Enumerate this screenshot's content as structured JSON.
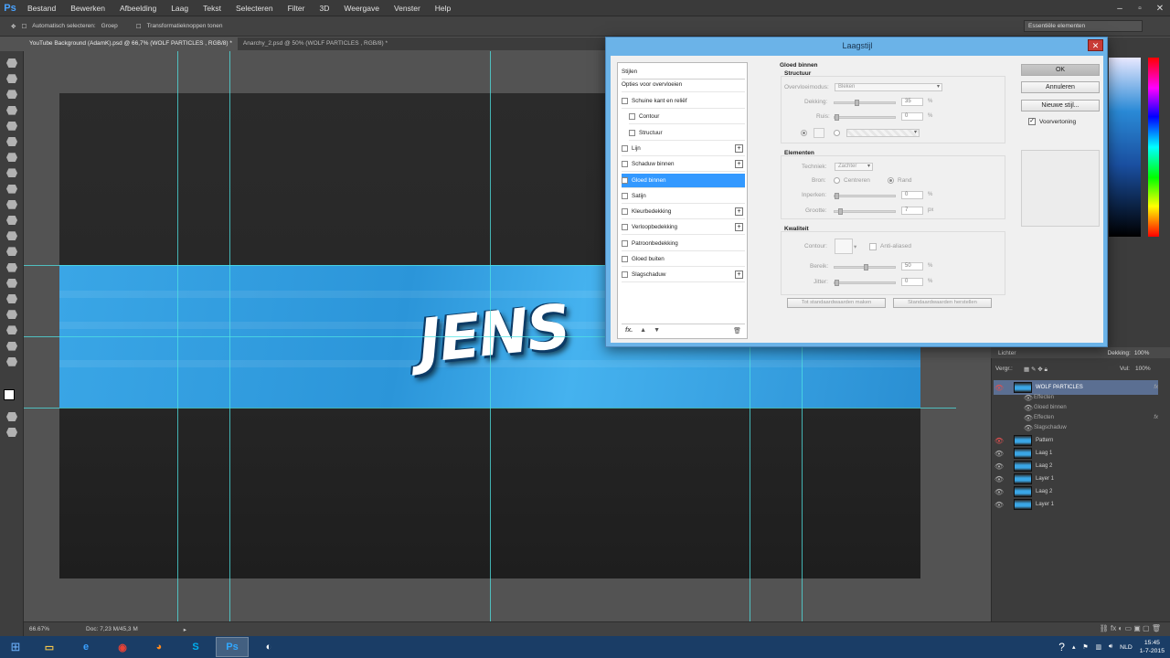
{
  "app": {
    "logo": "Ps",
    "menu": [
      "Bestand",
      "Bewerken",
      "Afbeelding",
      "Laag",
      "Tekst",
      "Selecteren",
      "Filter",
      "3D",
      "Weergave",
      "Venster",
      "Help"
    ],
    "options_bar": {
      "auto_select": "Automatisch selecteren:",
      "auto_select_value": "Groep",
      "transform": "Transformatieknoppen tonen",
      "workspace": "Essentiële elementen"
    },
    "tabs": [
      "YouTube Background (AdamK).psd @ 66,7% (WOLF PARTICLES , RGB/8) *",
      "Anarchy_2.psd @ 50% (WOLF PARTICLES , RGB/8) *"
    ],
    "status": {
      "zoom": "66.67%",
      "doc": "Doc: 7,23 M/45,3 M"
    }
  },
  "artwork": {
    "logo_text": "JENS"
  },
  "dialog": {
    "title": "Laagstijl",
    "styles_list": {
      "header": "Stijlen",
      "blending": "Opties voor overvloeien",
      "items": [
        {
          "label": "Schuine kant en reliëf",
          "plus": false,
          "indent": false,
          "selected": false
        },
        {
          "label": "Contour",
          "plus": false,
          "indent": true,
          "selected": false
        },
        {
          "label": "Structuur",
          "plus": false,
          "indent": true,
          "selected": false
        },
        {
          "label": "Lijn",
          "plus": true,
          "indent": false,
          "selected": false
        },
        {
          "label": "Schaduw binnen",
          "plus": true,
          "indent": false,
          "selected": false
        },
        {
          "label": "Gloed binnen",
          "plus": false,
          "indent": false,
          "selected": true
        },
        {
          "label": "Satijn",
          "plus": false,
          "indent": false,
          "selected": false
        },
        {
          "label": "Kleurbedekking",
          "plus": true,
          "indent": false,
          "selected": false
        },
        {
          "label": "Verloopbedekking",
          "plus": true,
          "indent": false,
          "selected": false
        },
        {
          "label": "Patroonbedekking",
          "plus": false,
          "indent": false,
          "selected": false
        },
        {
          "label": "Gloed buiten",
          "plus": false,
          "indent": false,
          "selected": false
        },
        {
          "label": "Slagschaduw",
          "plus": true,
          "indent": false,
          "selected": false
        }
      ],
      "footer_fx": "fx."
    },
    "settings": {
      "section_title": "Gloed binnen",
      "structure_title": "Structuur",
      "blend_mode_label": "Overvloeimodus:",
      "blend_mode_value": "Bleken",
      "opacity_label": "Dekking:",
      "opacity_value": "35",
      "noise_label": "Ruis:",
      "noise_value": "0",
      "elements_title": "Elementen",
      "technique_label": "Techniek:",
      "technique_value": "Zachter",
      "source_label": "Bron:",
      "source_center": "Centreren",
      "source_edge": "Rand",
      "choke_label": "Inperken:",
      "choke_value": "0",
      "size_label": "Grootte:",
      "size_value": "7",
      "quality_title": "Kwaliteit",
      "contour_label": "Contour:",
      "antialias_label": "Anti-aliased",
      "range_label": "Bereik:",
      "range_value": "50",
      "jitter_label": "Jitter:",
      "jitter_value": "0",
      "percent": "%",
      "px": "px",
      "make_default": "Tot standaardwaarden maken",
      "reset_default": "Standaardwaarden herstellen"
    },
    "buttons": {
      "ok": "OK",
      "cancel": "Annuleren",
      "new_style": "Nieuwe stijl...",
      "preview": "Voorvertoning"
    }
  },
  "layers": {
    "blend_mode": "Lichter",
    "opacity_label": "Dekking:",
    "opacity_value": "100%",
    "fill_label": "Vul:",
    "fill_value": "100%",
    "lock_label": "Vergr.:",
    "rows": [
      {
        "label": "WOLF PARTICLES",
        "kind": "layer",
        "fx": true,
        "selected": true
      },
      {
        "label": "Effecten",
        "kind": "sub",
        "fx": false,
        "selected": false
      },
      {
        "label": "Gloed binnen",
        "kind": "sub",
        "fx": false,
        "selected": false
      },
      {
        "label": "Effecten",
        "kind": "sub",
        "fx": true,
        "selected": false
      },
      {
        "label": "Slagschaduw",
        "kind": "sub",
        "fx": false,
        "selected": false
      },
      {
        "label": "Pattern",
        "kind": "layer",
        "fx": false,
        "selected": false
      },
      {
        "label": "Laag 1",
        "kind": "layer",
        "fx": false,
        "selected": false
      },
      {
        "label": "Laag 2",
        "kind": "layer",
        "fx": false,
        "selected": false
      },
      {
        "label": "Layer 1",
        "kind": "layer",
        "fx": false,
        "selected": false
      },
      {
        "label": "Laag 2",
        "kind": "layer",
        "fx": false,
        "selected": false
      },
      {
        "label": "Layer 1",
        "kind": "layer",
        "fx": false,
        "selected": false
      }
    ]
  },
  "taskbar": {
    "language": "NLD",
    "time": "15:45",
    "date": "1-7-2015",
    "apps": [
      {
        "name": "file-explorer-icon",
        "glyph": "▭",
        "color": "#f3c44b",
        "active": false
      },
      {
        "name": "internet-explorer-icon",
        "glyph": "e",
        "color": "#3aa0ff",
        "active": false
      },
      {
        "name": "chrome-icon",
        "glyph": "◉",
        "color": "#e94235",
        "active": false
      },
      {
        "name": "firefox-icon",
        "glyph": "◕",
        "color": "#ff8a1c",
        "active": false
      },
      {
        "name": "skype-icon",
        "glyph": "S",
        "color": "#00aff0",
        "active": false
      },
      {
        "name": "photoshop-icon",
        "glyph": "Ps",
        "color": "#31a8ff",
        "active": true
      },
      {
        "name": "obs-icon",
        "glyph": "◐",
        "color": "#ffffff",
        "active": false
      }
    ]
  },
  "colors": {
    "banner": "#3aa6e6",
    "guide": "#4fe3e3",
    "selection": "#3399ff",
    "dialog_frame": "#6bb3e8"
  }
}
